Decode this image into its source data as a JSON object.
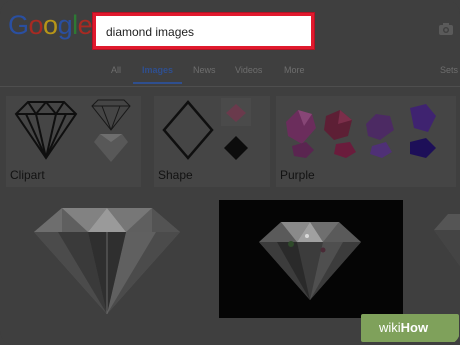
{
  "logo": {
    "letters": [
      "G",
      "o",
      "o",
      "g",
      "l",
      "e"
    ],
    "colors": [
      "#2a4fa0",
      "#a82a22",
      "#b79518",
      "#2a4fa0",
      "#2d7a34",
      "#a82a22"
    ]
  },
  "search": {
    "value": "diamond images",
    "highlight_color": "#e0192d"
  },
  "tabs": [
    {
      "label": "All",
      "active": false
    },
    {
      "label": "Images",
      "active": true
    },
    {
      "label": "News",
      "active": false
    },
    {
      "label": "Videos",
      "active": false
    },
    {
      "label": "More",
      "active": false
    },
    {
      "label": "Sets",
      "active": false
    }
  ],
  "related": [
    {
      "label": "Clipart"
    },
    {
      "label": "Shape"
    },
    {
      "label": "Purple"
    }
  ],
  "icons": {
    "camera": "camera-icon"
  },
  "watermark": {
    "text_wiki": "wiki",
    "text_how": "How",
    "color": "#7fa15b"
  }
}
